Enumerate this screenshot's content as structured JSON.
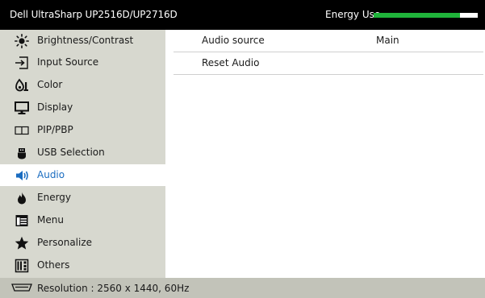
{
  "header": {
    "model": "Dell UltraSharp UP2516D/UP2716D",
    "energy_label": "Energy Use",
    "energy_level": 0.83,
    "energy_color": "#1fb33a"
  },
  "sidebar": {
    "selected": "Audio",
    "items": [
      {
        "label": "Brightness/Contrast",
        "icon": "sun-icon"
      },
      {
        "label": "Input Source",
        "icon": "input-icon"
      },
      {
        "label": "Color",
        "icon": "color-icon"
      },
      {
        "label": "Display",
        "icon": "monitor-icon"
      },
      {
        "label": "PIP/PBP",
        "icon": "pip-icon"
      },
      {
        "label": "USB Selection",
        "icon": "usb-icon"
      },
      {
        "label": "Audio",
        "icon": "speaker-icon"
      },
      {
        "label": "Energy",
        "icon": "flame-icon"
      },
      {
        "label": "Menu",
        "icon": "menu-icon"
      },
      {
        "label": "Personalize",
        "icon": "star-icon"
      },
      {
        "label": "Others",
        "icon": "others-icon"
      }
    ]
  },
  "content": {
    "rows": [
      {
        "label": "Audio source",
        "value": "Main"
      },
      {
        "label": "Reset Audio",
        "value": ""
      }
    ]
  },
  "status": {
    "resolution": "Resolution : 2560 x 1440, 60Hz",
    "icon": "connector-icon"
  },
  "colors": {
    "sidebar_bg": "#d7d8cf",
    "status_bg": "#c2c3b9",
    "selected_text": "#1a6cc0"
  }
}
